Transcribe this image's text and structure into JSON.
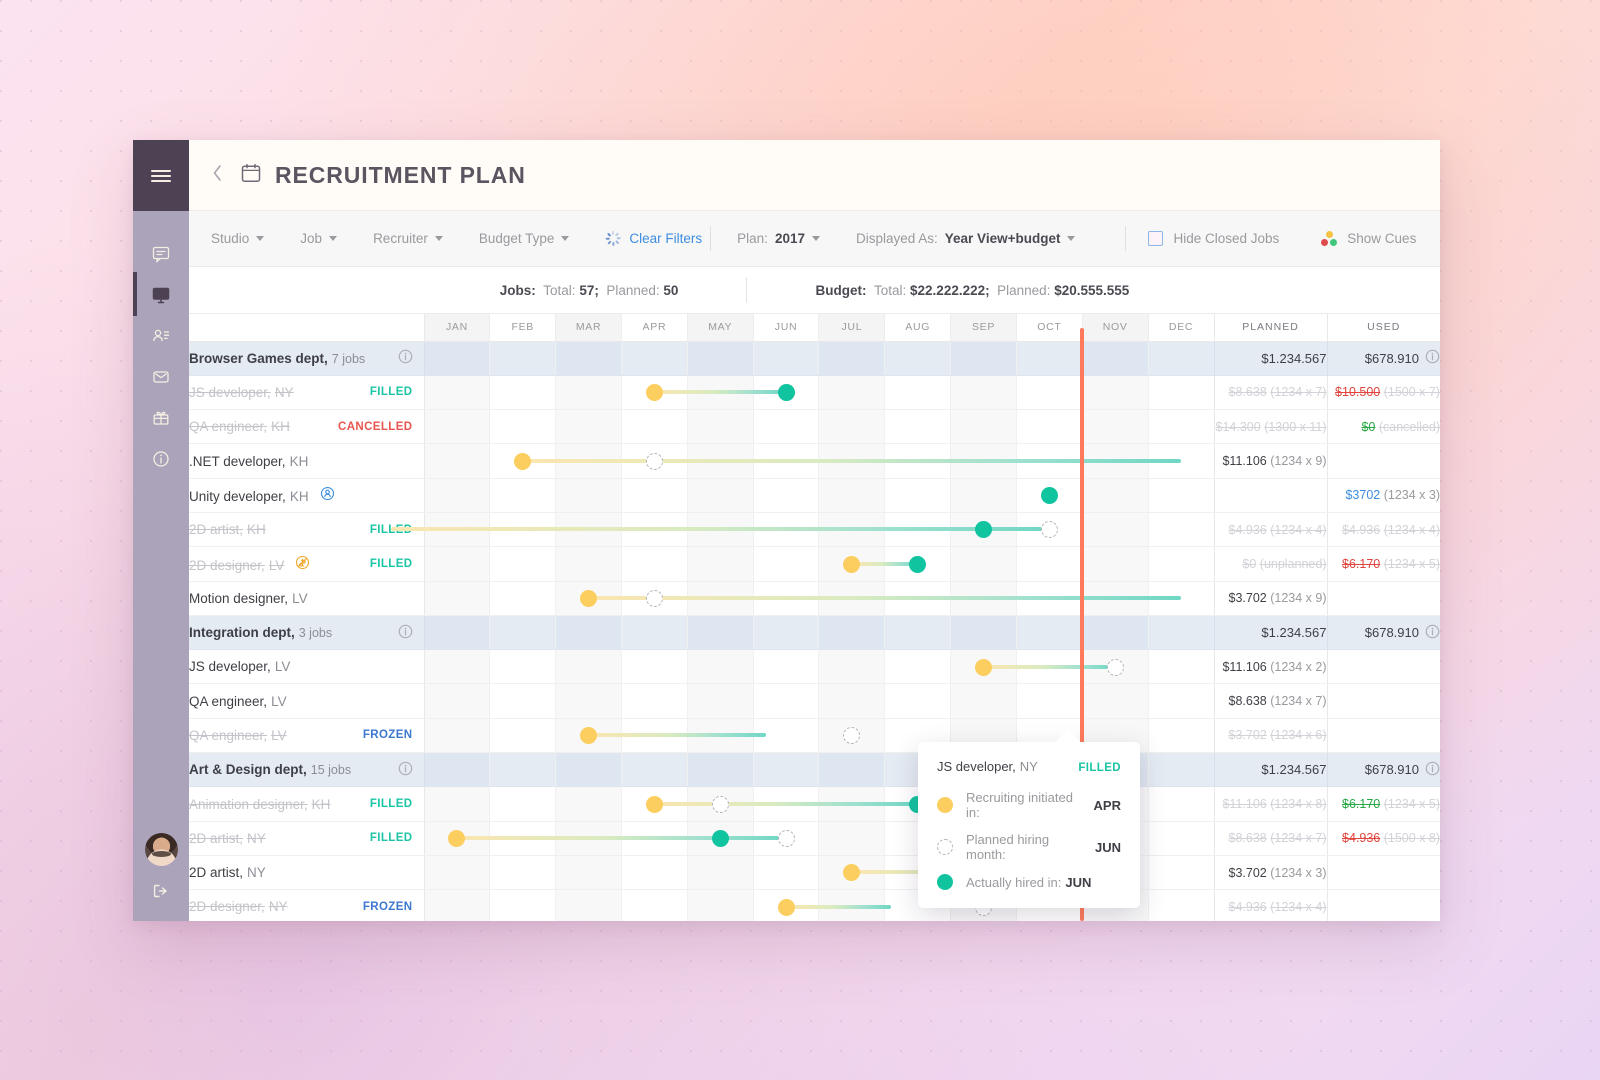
{
  "sidebar": {
    "menu_icon": "hamburger-icon",
    "items": [
      {
        "icon": "chat-icon",
        "active": false
      },
      {
        "icon": "monitor-icon",
        "active": true
      },
      {
        "icon": "contact-card-icon",
        "active": false
      },
      {
        "icon": "envelope-icon",
        "active": false
      },
      {
        "icon": "gift-icon",
        "active": false
      },
      {
        "icon": "info-icon",
        "active": false
      }
    ],
    "avatar": "user-avatar",
    "logout_icon": "logout-icon"
  },
  "header": {
    "back_icon": "chevron-left-icon",
    "calendar_icon": "calendar-icon",
    "title": "RECRUITMENT PLAN"
  },
  "toolbar": {
    "filters": [
      {
        "label": "Studio"
      },
      {
        "label": "Job"
      },
      {
        "label": "Recruiter"
      },
      {
        "label": "Budget Type"
      }
    ],
    "clear_filters": "Clear Filters",
    "plan_label": "Plan:",
    "plan_value": "2017",
    "displayed_label": "Displayed As:",
    "displayed_value": "Year View+budget",
    "hide_closed": "Hide Closed Jobs",
    "hide_closed_checked": false,
    "show_cues": "Show Cues"
  },
  "summary": {
    "jobs_label": "Jobs:",
    "jobs_total_label": "Total:",
    "jobs_total": "57;",
    "jobs_planned_label": "Planned:",
    "jobs_planned": "50",
    "budget_label": "Budget:",
    "budget_total_label": "Total:",
    "budget_total": "$22.222.222;",
    "budget_planned_label": "Planned:",
    "budget_planned": "$20.555.555"
  },
  "grid": {
    "months": [
      "JAN",
      "FEB",
      "MAR",
      "APR",
      "MAY",
      "JUN",
      "JUL",
      "AUG",
      "SEP",
      "OCT",
      "NOV",
      "DEC"
    ],
    "planned_header": "PLANNED",
    "used_header": "USED",
    "today_marker_month_index": 10,
    "rows": [
      {
        "type": "dept",
        "name": "Browser Games dept,",
        "jobs": "7 jobs",
        "planned": "$1.234.567",
        "used": "$678.910"
      },
      {
        "type": "job",
        "title": "JS developer,",
        "loc": "NY",
        "status": "FILLED",
        "status_kind": "filled",
        "closed": true,
        "planned_amt": "$8.638",
        "planned_mult": "(1234 x 7)",
        "used_amt": "$10.500",
        "used_mult": "(1500 x 7)",
        "used_kind": "red",
        "start": 3,
        "planned_hire": 5,
        "actual_hire": 5
      },
      {
        "type": "job",
        "title": "QA engineer,",
        "loc": "KH",
        "status": "CANCELLED",
        "status_kind": "cancelled",
        "closed": true,
        "planned_amt": "$14.300",
        "planned_mult": "(1300 x 11)",
        "used_amt": "$0",
        "used_mult": "(cancelled)",
        "used_kind": "green",
        "start": null,
        "planned_hire": null,
        "actual_hire": null
      },
      {
        "type": "job",
        "title": ".NET developer,",
        "loc": "KH",
        "status": "",
        "status_kind": "",
        "closed": false,
        "planned_amt": "$11.106",
        "planned_mult": "(1234 x 9)",
        "used_amt": "",
        "used_mult": "",
        "used_kind": "",
        "start": 1,
        "planned_hire": 3,
        "actual_hire": null,
        "bar_end": 11
      },
      {
        "type": "job",
        "title": "Unity developer,",
        "loc": "KH",
        "status": "",
        "status_kind": "",
        "closed": false,
        "badge": "rehire-icon",
        "planned_amt": "",
        "planned_mult": "",
        "used_amt": "$3702",
        "used_mult": "(1234 x 3)",
        "used_kind": "blue",
        "start": null,
        "planned_hire": null,
        "actual_hire": 9
      },
      {
        "type": "job",
        "title": "2D artist,",
        "loc": "KH",
        "status": "FILLED",
        "status_kind": "filled",
        "closed": true,
        "planned_amt": "$4.936",
        "planned_mult": "(1234 x 4)",
        "used_amt": "$4.936",
        "used_mult": "(1234 x 4)",
        "used_kind": "",
        "start": null,
        "planned_hire": 9,
        "actual_hire": 8,
        "bar_start": -1
      },
      {
        "type": "job",
        "title": "2D designer,",
        "loc": "LV",
        "status": "FILLED",
        "status_kind": "filled",
        "closed": true,
        "badge": "no-budget-icon",
        "planned_amt": "$0",
        "planned_mult": "(unplanned)",
        "used_amt": "$6.170",
        "used_mult": "(1234 x 5)",
        "used_kind": "red",
        "start": 6,
        "planned_hire": null,
        "actual_hire": 7
      },
      {
        "type": "job",
        "title": "Motion designer,",
        "loc": "LV",
        "status": "",
        "status_kind": "",
        "closed": false,
        "planned_amt": "$3.702",
        "planned_mult": "(1234 x 9)",
        "used_amt": "",
        "used_mult": "",
        "used_kind": "",
        "start": 2,
        "planned_hire": 3,
        "actual_hire": null,
        "bar_end": 11
      },
      {
        "type": "dept",
        "name": "Integration dept,",
        "jobs": "3 jobs",
        "planned": "$1.234.567",
        "used": "$678.910"
      },
      {
        "type": "job",
        "title": "JS developer,",
        "loc": "LV",
        "status": "",
        "status_kind": "",
        "closed": false,
        "planned_amt": "$11.106",
        "planned_mult": "(1234 x 2)",
        "used_amt": "",
        "used_mult": "",
        "used_kind": "",
        "start": 8,
        "planned_hire": 10,
        "actual_hire": null,
        "bar_end": 10
      },
      {
        "type": "job",
        "title": "QA engineer,",
        "loc": "LV",
        "status": "",
        "status_kind": "",
        "closed": false,
        "planned_amt": "$8.638",
        "planned_mult": "(1234 x 7)",
        "used_amt": "",
        "used_mult": "",
        "used_kind": "",
        "start": null,
        "planned_hire": null,
        "actual_hire": null
      },
      {
        "type": "job",
        "title": "QA engineer,",
        "loc": "LV",
        "status": "FROZEN",
        "status_kind": "frozen",
        "closed": true,
        "planned_amt": "$3.702",
        "planned_mult": "(1234 x 6)",
        "used_amt": "",
        "used_mult": "",
        "used_kind": "",
        "start": 2,
        "planned_hire": 6,
        "actual_hire": null,
        "bar_end": 4.7
      },
      {
        "type": "dept",
        "name": "Art & Design dept,",
        "jobs": "15 jobs",
        "planned": "$1.234.567",
        "used": "$678.910"
      },
      {
        "type": "job",
        "title": "Animation designer,",
        "loc": "KH",
        "status": "FILLED",
        "status_kind": "filled",
        "closed": true,
        "planned_amt": "$11.106",
        "planned_mult": "(1234 x 8)",
        "used_amt": "$6.170",
        "used_mult": "(1234 x 5)",
        "used_kind": "green",
        "start": 3,
        "planned_hire": 4,
        "actual_hire": 7
      },
      {
        "type": "job",
        "title": "2D artist,",
        "loc": "NY",
        "status": "FILLED",
        "status_kind": "filled",
        "closed": true,
        "planned_amt": "$8.638",
        "planned_mult": "(1234 x 7)",
        "used_amt": "$4.936",
        "used_mult": "(1500 x 8)",
        "used_kind": "red",
        "start": 0,
        "planned_hire": 5,
        "actual_hire": 4
      },
      {
        "type": "job",
        "title": "2D artist,",
        "loc": "NY",
        "status": "",
        "status_kind": "",
        "closed": false,
        "planned_amt": "$3.702",
        "planned_mult": "(1234 x 3)",
        "used_amt": "",
        "used_mult": "",
        "used_kind": "",
        "start": 6,
        "planned_hire": 9,
        "actual_hire": null
      },
      {
        "type": "job",
        "title": "2D designer,",
        "loc": "NY",
        "status": "FROZEN",
        "status_kind": "frozen",
        "closed": true,
        "planned_amt": "$4.936",
        "planned_mult": "(1234 x 4)",
        "used_amt": "",
        "used_mult": "",
        "used_kind": "",
        "start": 5,
        "planned_hire": 8,
        "actual_hire": null,
        "bar_end": 6.6
      }
    ]
  },
  "tooltip": {
    "title": "JS developer,",
    "loc": "NY",
    "status": "FILLED",
    "rows": [
      {
        "dot": "yellow",
        "label": "Recruiting initiated in:",
        "value": "APR"
      },
      {
        "dot": "dash",
        "label": "Planned hiring month:",
        "value": "JUN"
      },
      {
        "dot": "teal",
        "label": "Actually hired in:",
        "value": "JUN"
      }
    ]
  },
  "colors": {
    "accent_teal": "#11c4a0",
    "accent_yellow": "#fcce60",
    "danger": "#e0453f",
    "success": "#28a745",
    "link": "#3d8ee0",
    "today": "#ff7a5c",
    "sidebar": "#aba3b9",
    "sidebar_dark": "#4d4254"
  }
}
